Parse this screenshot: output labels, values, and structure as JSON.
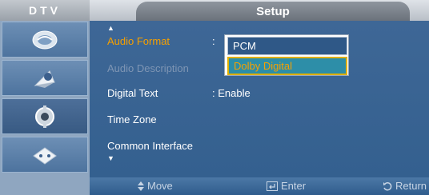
{
  "header": {
    "source": "DTV",
    "title": "Setup"
  },
  "sidebar": {
    "items": [
      {
        "icon": "picture-icon"
      },
      {
        "icon": "sound-icon"
      },
      {
        "icon": "setup-gear-icon"
      },
      {
        "icon": "input-icon"
      }
    ]
  },
  "menu": {
    "rows": [
      {
        "label": "Audio Format",
        "value": ":"
      },
      {
        "label": "Audio Description",
        "value": ""
      },
      {
        "label": "Digital Text",
        "value": ": Enable"
      },
      {
        "label": "Time Zone",
        "value": ""
      },
      {
        "label": "Common Interface",
        "value": ""
      }
    ],
    "dropdown": {
      "options": [
        "PCM",
        "Dolby Digital"
      ]
    }
  },
  "footer": {
    "move": "Move",
    "enter": "Enter",
    "return": "Return"
  },
  "colors": {
    "accent": "#f6a000",
    "panel": "#3e6796",
    "dim_text": "#7e95b4"
  }
}
